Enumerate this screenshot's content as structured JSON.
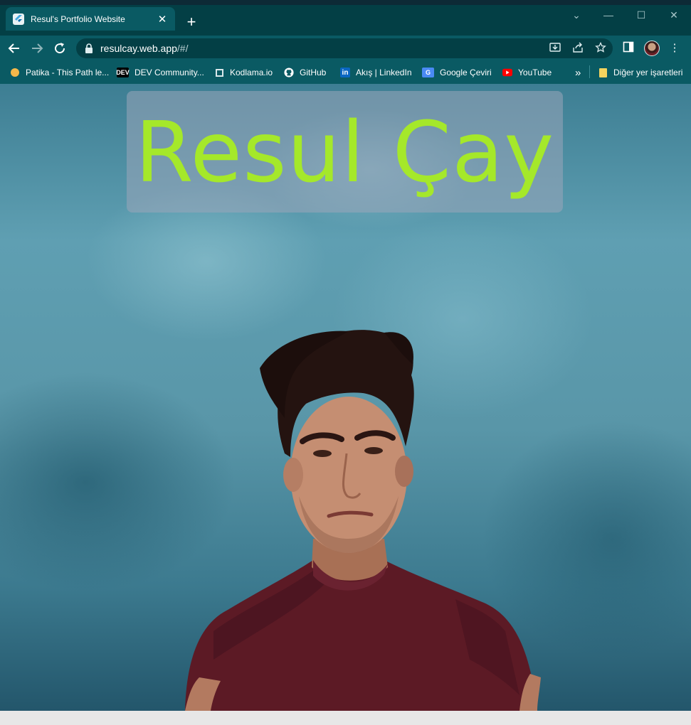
{
  "browser": {
    "tab": {
      "title": "Resul's Portfolio Website",
      "favicon": "flutter-icon"
    },
    "new_tab_label": "+",
    "window_controls": {
      "collapse": "⌄",
      "minimize": "—",
      "maximize": "☐",
      "close": "✕"
    },
    "address": {
      "host": "resulcay.web.app",
      "path": "/#/"
    },
    "bookmarks": [
      {
        "label": "Patika - This Path le...",
        "icon": "patika-icon"
      },
      {
        "label": "DEV Community...",
        "icon": "dev-icon",
        "icon_text": "DEV"
      },
      {
        "label": "Kodlama.io",
        "icon": "kodlama-icon"
      },
      {
        "label": "GitHub",
        "icon": "github-icon"
      },
      {
        "label": "Akış | LinkedIn",
        "icon": "linkedin-icon",
        "icon_text": "in"
      },
      {
        "label": "Google Çeviri",
        "icon": "google-translate-icon",
        "icon_text": "G"
      },
      {
        "label": "YouTube",
        "icon": "youtube-icon"
      }
    ],
    "bookmarks_overflow": "»",
    "other_bookmarks": "Diğer yer işaretleri"
  },
  "page": {
    "heading": "Resul Çay",
    "heading_color": "#a5e82a"
  },
  "colors": {
    "frame": "#033f45",
    "toolbar": "#0a5a63"
  }
}
